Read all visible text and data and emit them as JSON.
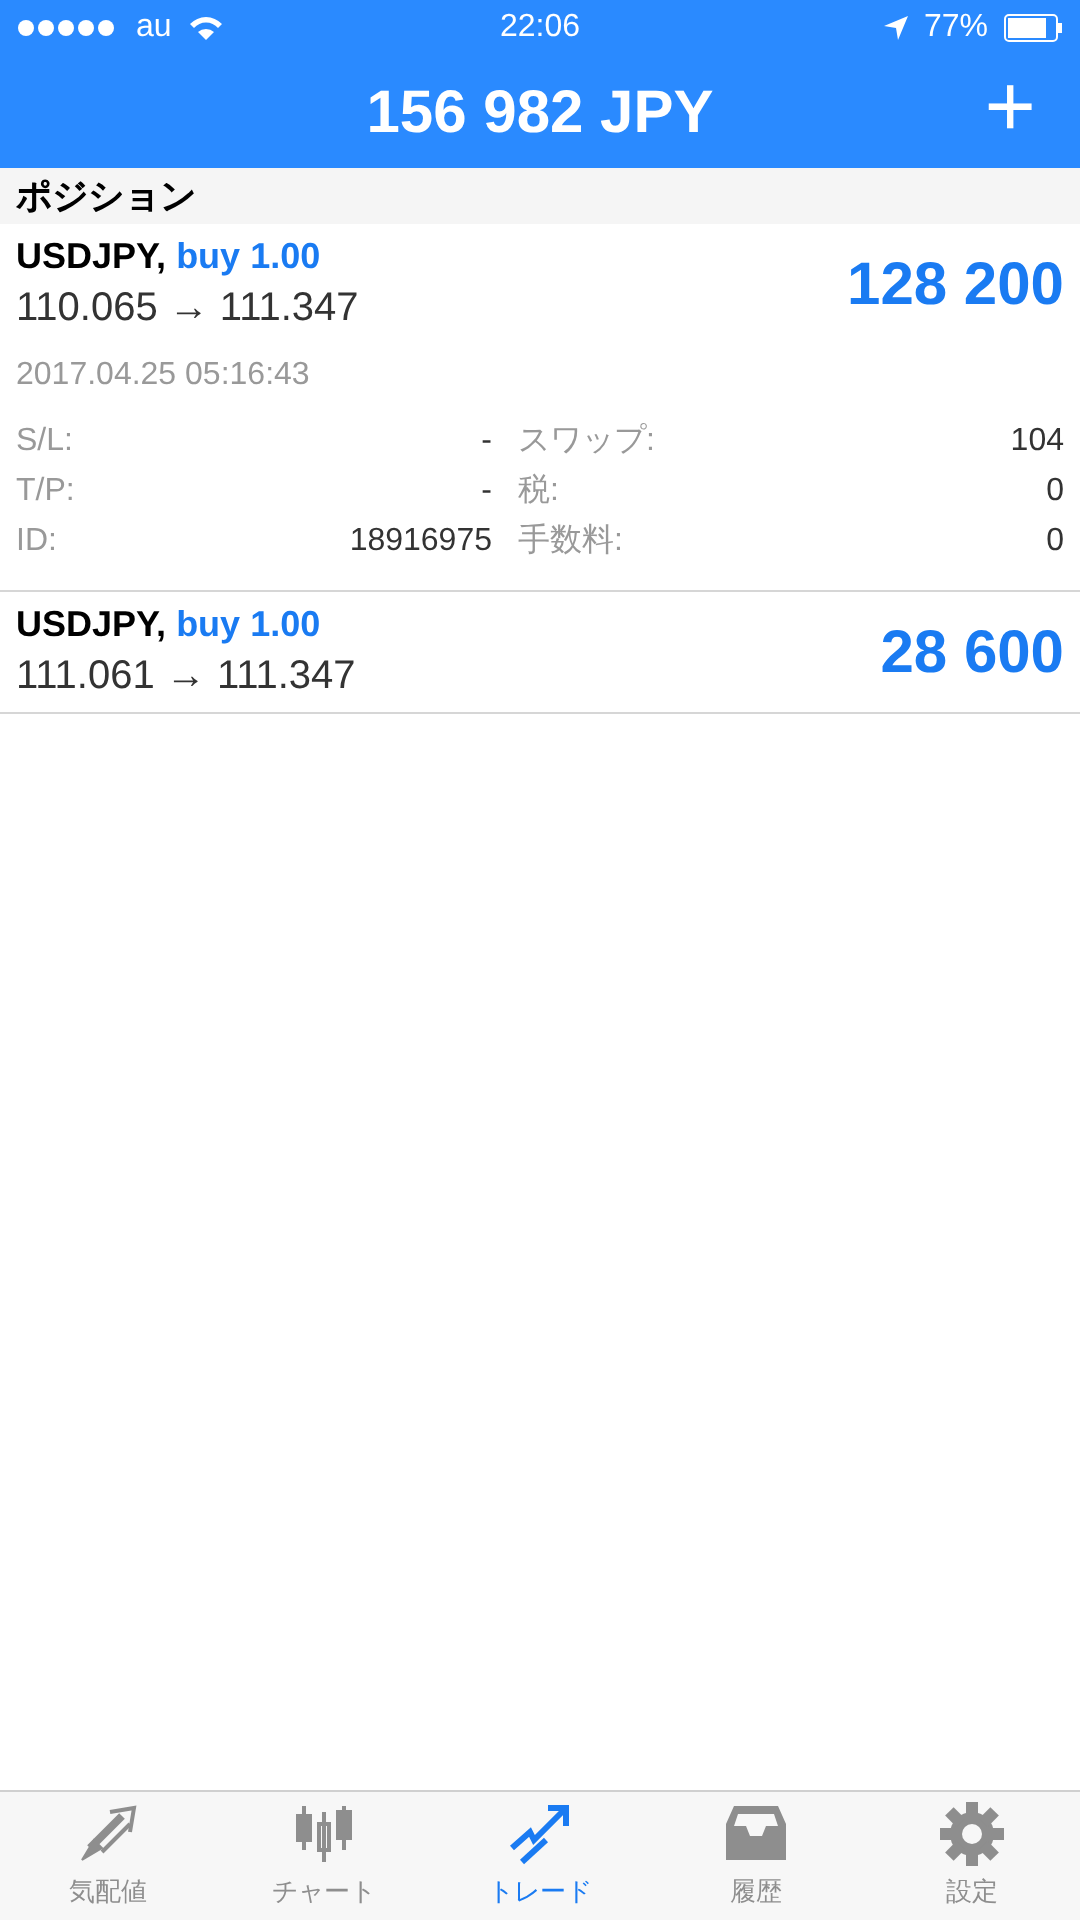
{
  "status_bar": {
    "carrier": "au",
    "time": "22:06",
    "battery": "77%"
  },
  "header": {
    "title": "156 982 JPY",
    "add_button": "+"
  },
  "section": {
    "title": "ポジション"
  },
  "positions": [
    {
      "symbol": "USDJPY,",
      "side": "buy 1.00",
      "prices": "110.065 → 111.347",
      "profit": "128 200",
      "expanded": true,
      "time": "2017.04.25 05:16:43",
      "details": [
        [
          "S/L:",
          "-",
          "スワップ:",
          "104"
        ],
        [
          "T/P:",
          "-",
          "税:",
          "0"
        ],
        [
          "ID:",
          "18916975",
          "手数料:",
          "0"
        ]
      ]
    },
    {
      "symbol": "USDJPY,",
      "side": "buy 1.00",
      "prices": "111.061 → 111.347",
      "profit": "28 600",
      "expanded": false
    }
  ],
  "tabs": [
    {
      "label": "気配値",
      "kind": "quotes",
      "selected": false
    },
    {
      "label": "チャート",
      "kind": "chart",
      "selected": false
    },
    {
      "label": "トレード",
      "kind": "trade",
      "selected": true
    },
    {
      "label": "履歴",
      "kind": "history",
      "selected": false
    },
    {
      "label": "設定",
      "kind": "settings",
      "selected": false
    }
  ]
}
